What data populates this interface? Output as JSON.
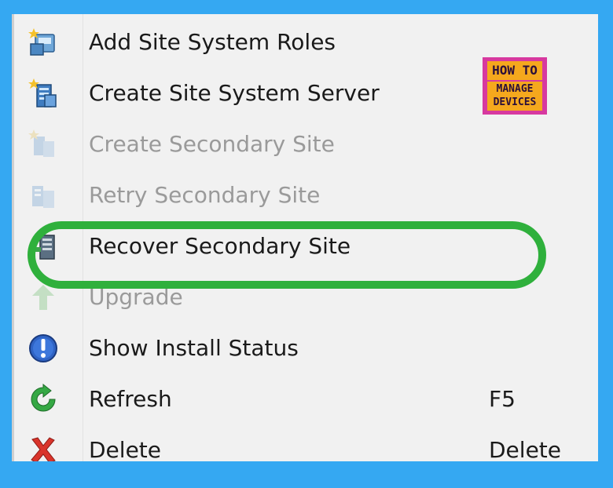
{
  "menu": {
    "items": [
      {
        "label": "Add Site System Roles",
        "icon": "add-site-system-roles-icon",
        "enabled": true
      },
      {
        "label": "Create Site System Server",
        "icon": "create-site-system-server-icon",
        "enabled": true
      },
      {
        "label": "Create Secondary Site",
        "icon": "create-secondary-site-icon",
        "enabled": false
      },
      {
        "label": "Retry Secondary Site",
        "icon": "retry-secondary-site-icon",
        "enabled": false
      },
      {
        "label": "Recover Secondary Site",
        "icon": "recover-secondary-site-icon",
        "enabled": true,
        "highlighted": true
      },
      {
        "label": "Upgrade",
        "icon": "upgrade-arrow-icon",
        "enabled": false
      },
      {
        "label": "Show Install Status",
        "icon": "info-exclamation-icon",
        "enabled": true
      },
      {
        "label": "Refresh",
        "icon": "refresh-icon",
        "enabled": true,
        "shortcut": "F5"
      },
      {
        "label": "Delete",
        "icon": "delete-x-icon",
        "enabled": true,
        "shortcut": "Delete"
      }
    ]
  },
  "logo": {
    "line1": "HOW TO",
    "line2": "MANAGE",
    "line3": "DEVICES"
  },
  "colors": {
    "frame": "#35a8f2",
    "menu_background": "#f1f1f1",
    "highlight_ring": "#2fb03c",
    "logo_magenta": "#d7399f",
    "logo_orange": "#f5a81d",
    "disabled_text": "#9a9a9a"
  }
}
